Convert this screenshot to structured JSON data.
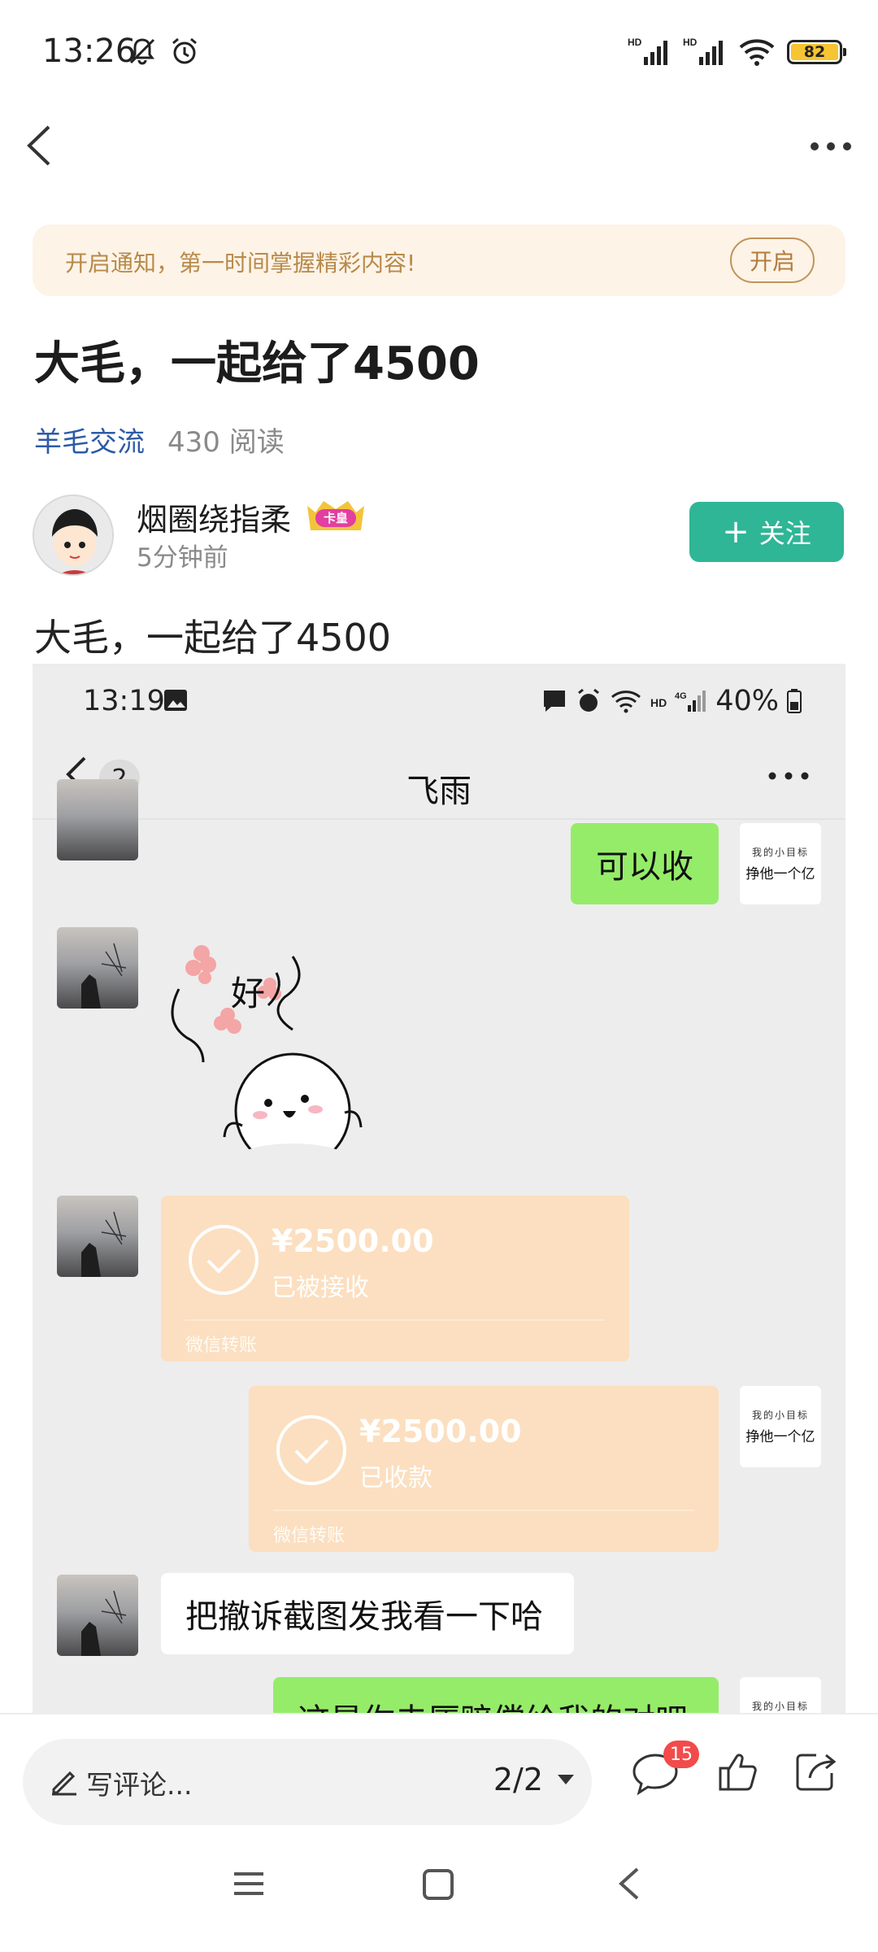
{
  "status_bar": {
    "time": "13:26",
    "battery": "82",
    "network_labels": [
      "HD",
      "HD"
    ]
  },
  "notify_banner": {
    "text": "开启通知，第一时间掌握精彩内容!",
    "button": "开启"
  },
  "post": {
    "title": "大毛，一起给了4500",
    "group": "羊毛交流",
    "reads": "430 阅读",
    "body": "大毛，一起给了4500"
  },
  "author": {
    "name": "烟圈绕指柔",
    "badge": "卡皇",
    "time": "5分钟前",
    "follow_label": "关注"
  },
  "screenshot": {
    "time": "13:19",
    "battery": "40%",
    "unread": "2",
    "contact_name": "飞雨",
    "messages": {
      "m1": "可以收",
      "sticker_text": "好",
      "transfer1_amount": "¥2500.00",
      "transfer1_status": "已被接收",
      "transfer1_footer": "微信转账",
      "transfer2_amount": "¥2500.00",
      "transfer2_status": "已收款",
      "transfer2_footer": "微信转账",
      "m4": "把撤诉截图发我看一下哈",
      "m5_partial": "这是你去厦赔偿给我的对吧"
    },
    "my_avatar_lines": [
      "我的小目标",
      "挣他一个亿"
    ]
  },
  "bottom_bar": {
    "comment_placeholder": "写评论...",
    "page": "2/2",
    "comment_count": "15"
  },
  "colors": {
    "accent_green": "#2fb696",
    "link_blue": "#2d5aa7",
    "wechat_green": "#95ec69",
    "transfer_orange": "#fbdfc0",
    "badge_red": "#f24b4b"
  }
}
